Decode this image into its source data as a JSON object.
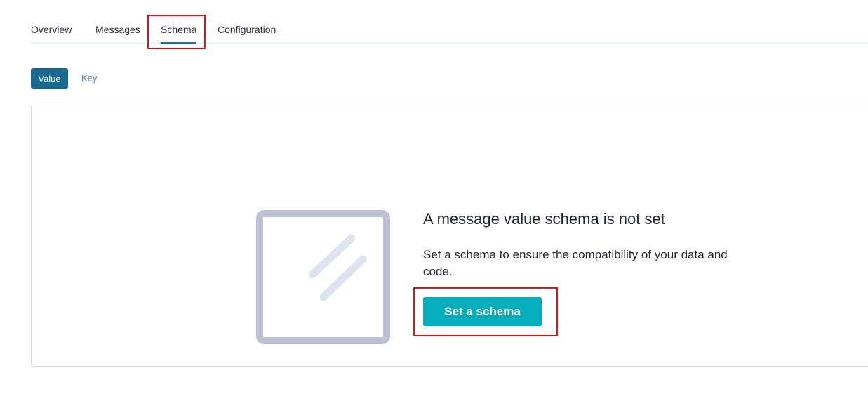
{
  "tabs": [
    {
      "label": "Overview"
    },
    {
      "label": "Messages"
    },
    {
      "label": "Schema",
      "active": true
    },
    {
      "label": "Configuration"
    }
  ],
  "schema_toggle": {
    "options": [
      "Value",
      "Key"
    ],
    "selected": "Value"
  },
  "empty_state": {
    "icon": "empty-schema-illustration-icon",
    "title": "A message value schema is not set",
    "description": "Set a schema to ensure the compatibility of your data and code.",
    "button_label": "Set a schema"
  },
  "colors": {
    "accent": "#1c6ea4",
    "toggle_active_bg": "#186a90",
    "primary_button": "#04aebc",
    "highlight": "#e0131a",
    "illustration_frame": "#bdc1d1",
    "illustration_slash": "#dde3ef"
  }
}
